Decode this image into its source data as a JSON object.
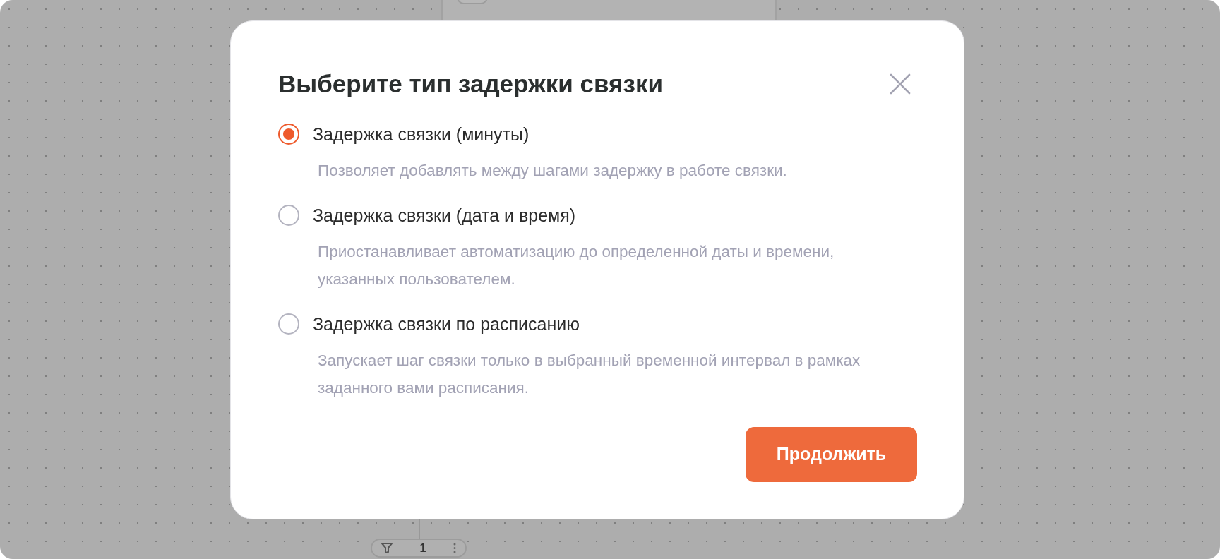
{
  "background": {
    "filter_pill": {
      "count": "1"
    }
  },
  "dialog": {
    "title": "Выберите тип задержки связки",
    "options": [
      {
        "label": "Задержка связки (минуты)",
        "description": "Позволяет добавлять между шагами задержку в работе связки.",
        "selected": true
      },
      {
        "label": "Задержка связки (дата и время)",
        "description": "Приостанавливает автоматизацию до определенной даты и времени, указанных пользователем.",
        "selected": false
      },
      {
        "label": "Задержка связки по расписанию",
        "description": "Запускает шаг связки только в выбранный временной интервал в рамках заданного вами расписания.",
        "selected": false
      }
    ],
    "button": "Продолжить"
  }
}
